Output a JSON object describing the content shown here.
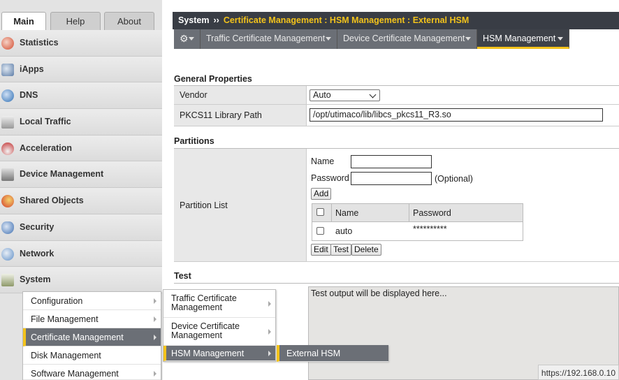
{
  "nav_tabs": [
    "Main",
    "Help",
    "About"
  ],
  "nav_items": [
    {
      "label": "Statistics",
      "icon": "statistics-icon",
      "color": "#d24a2e"
    },
    {
      "label": "iApps",
      "icon": "iapps-icon",
      "color": "#5b7ba6"
    },
    {
      "label": "DNS",
      "icon": "dns-icon",
      "color": "#2f6fb3"
    },
    {
      "label": "Local Traffic",
      "icon": "local-traffic-icon",
      "color": "#8c8c8c"
    },
    {
      "label": "Acceleration",
      "icon": "acceleration-icon",
      "color": "#c23030"
    },
    {
      "label": "Device Management",
      "icon": "device-management-icon",
      "color": "#7a7a7a"
    },
    {
      "label": "Shared Objects",
      "icon": "shared-objects-icon",
      "color": "#e2a22b"
    },
    {
      "label": "Security",
      "icon": "security-icon",
      "color": "#3f6fb0"
    },
    {
      "label": "Network",
      "icon": "network-icon",
      "color": "#5f8fc7"
    },
    {
      "label": "System",
      "icon": "system-icon",
      "color": "#8f9a6a"
    }
  ],
  "breadcrumb": {
    "root": "System",
    "separator": "››",
    "path": "Certificate Management : HSM Management : External HSM"
  },
  "menubar": {
    "gear": "⚙",
    "tabs": [
      "Traffic Certificate Management",
      "Device Certificate Management",
      "HSM Management"
    ],
    "active": "HSM Management"
  },
  "general": {
    "title": "General Properties",
    "vendor_label": "Vendor",
    "vendor_value": "Auto",
    "pkcs_label": "PKCS11 Library Path",
    "pkcs_value": "/opt/utimaco/lib/libcs_pkcs11_R3.so"
  },
  "partitions": {
    "title": "Partitions",
    "row_label": "Partition List",
    "name_label": "Name",
    "password_label": "Password",
    "optional_text": "(Optional)",
    "add_button": "Add",
    "col_name": "Name",
    "col_password": "Password",
    "rows": [
      {
        "name": "auto",
        "password": "**********"
      }
    ],
    "edit_button": "Edit",
    "test_button": "Test",
    "delete_button": "Delete"
  },
  "test": {
    "title": "Test",
    "output": "Test output will be displayed here..."
  },
  "flyout_system": [
    "Configuration",
    "File Management",
    "Certificate Management",
    "Disk Management",
    "Software Management"
  ],
  "flyout_cert": [
    "Traffic Certificate\nManagement",
    "Device Certificate\nManagement",
    "HSM Management"
  ],
  "flyout_hsm": [
    "External HSM"
  ],
  "status_url": "https://192.168.0.10",
  "colors": {
    "accent": "#f3c31b",
    "header": "#393d45",
    "menutab": "#6b6f76"
  }
}
